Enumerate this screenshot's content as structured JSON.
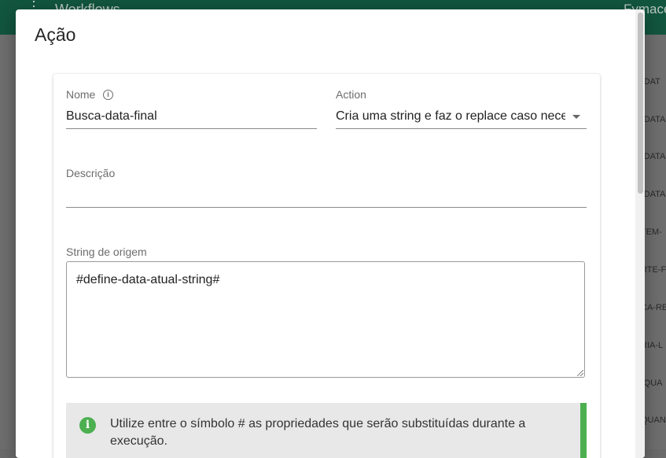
{
  "background": {
    "header_title": "Workflows",
    "header_right": "Fymace",
    "list_items": [
      "-DAT",
      "-DATA",
      "-DATA",
      "-DATA",
      "TEM-",
      "RTE-F",
      "CA-RE",
      "RIA-L",
      "-QUA",
      "QUAN"
    ]
  },
  "dialog": {
    "title": "Ação"
  },
  "form": {
    "nome": {
      "label": "Nome",
      "value": "Busca-data-final"
    },
    "action": {
      "label": "Action",
      "value": "Cria uma string e faz o replace caso nece"
    },
    "descricao": {
      "label": "Descrição",
      "value": ""
    },
    "string_origem": {
      "label": "String de origem",
      "value": "#define-data-atual-string#"
    }
  },
  "alert": {
    "icon": "info-icon",
    "text": "Utilize entre o símbolo # as propriedades que serão substituídas durante a execução.",
    "color": "#4caf50"
  },
  "colors": {
    "header": "#12563f",
    "accent": "#4caf50"
  }
}
